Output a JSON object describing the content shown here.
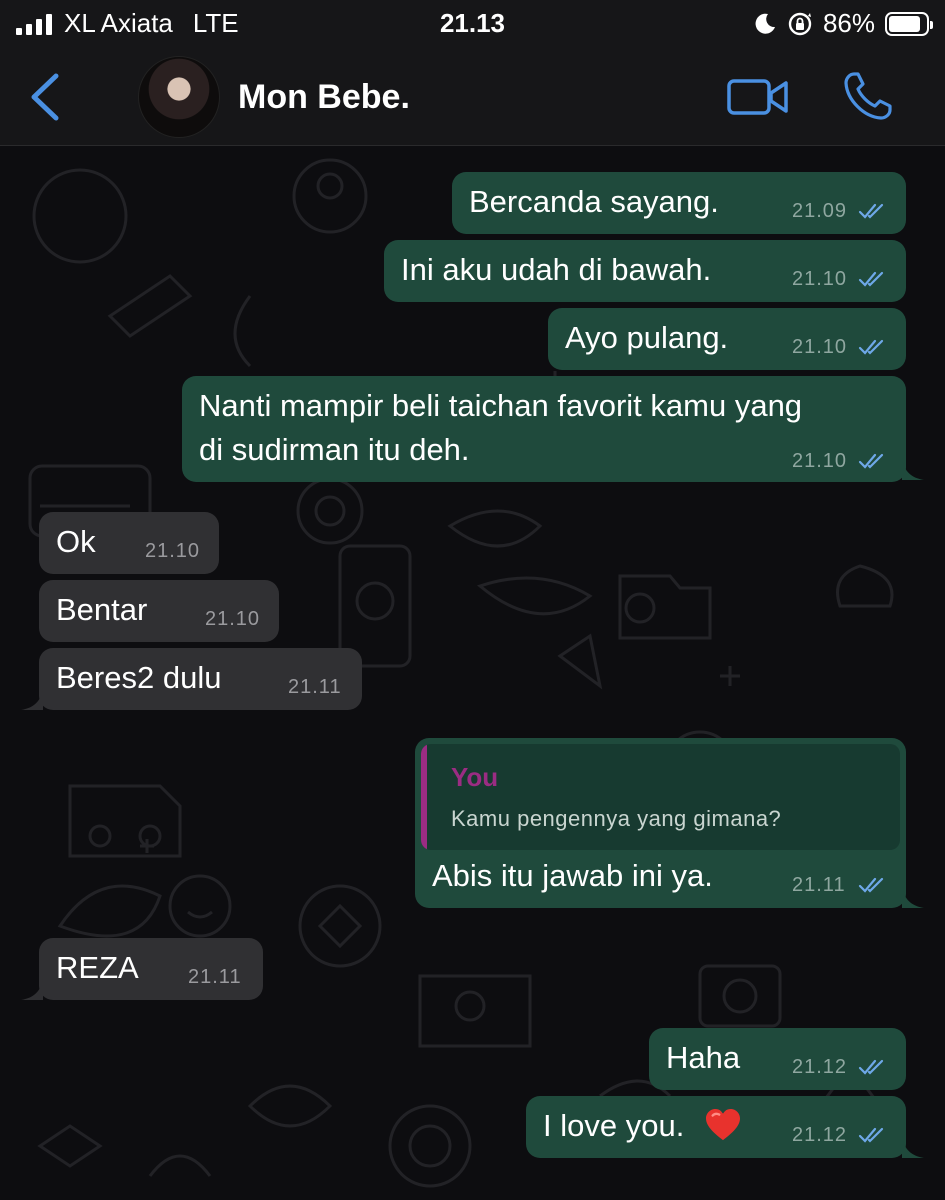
{
  "status_bar": {
    "carrier": "XL Axiata",
    "network": "LTE",
    "time": "21.13",
    "battery": "86%",
    "battery_level": 0.86
  },
  "header": {
    "contact_name": "Mon Bebe.",
    "icons": {
      "back": "chevron-left-icon",
      "video": "video-camera-icon",
      "call": "phone-icon"
    },
    "accent_color": "#4a90e2"
  },
  "colors": {
    "outgoing_bubble": "#1f4a3c",
    "incoming_bubble": "#303033",
    "read_ticks": "#6ea8e8",
    "quote_accent": "#9b2c83"
  },
  "messages": [
    {
      "direction": "out",
      "text": "Bercanda sayang.",
      "time": "21.09",
      "status": "read"
    },
    {
      "direction": "out",
      "text": "Ini aku udah di bawah.",
      "time": "21.10",
      "status": "read"
    },
    {
      "direction": "out",
      "text": "Ayo pulang.",
      "time": "21.10",
      "status": "read"
    },
    {
      "direction": "out",
      "text_line1": "Nanti mampir beli taichan favorit kamu yang",
      "text_line2": "di sudirman itu deh.",
      "time": "21.10",
      "status": "read"
    },
    {
      "direction": "in",
      "text": "Ok",
      "time": "21.10"
    },
    {
      "direction": "in",
      "text": "Bentar",
      "time": "21.10"
    },
    {
      "direction": "in",
      "text": "Beres2 dulu",
      "time": "21.11"
    },
    {
      "direction": "out",
      "reply_to_name": "You",
      "reply_to_text": "Kamu pengennya yang gimana?",
      "text": "Abis itu jawab ini ya.",
      "time": "21.11",
      "status": "read"
    },
    {
      "direction": "in",
      "text": "REZA",
      "time": "21.11"
    },
    {
      "direction": "out",
      "text": "Haha",
      "time": "21.12",
      "status": "read"
    },
    {
      "direction": "out",
      "text": "I love you.",
      "emoji": "red-heart",
      "time": "21.12",
      "status": "read"
    }
  ]
}
